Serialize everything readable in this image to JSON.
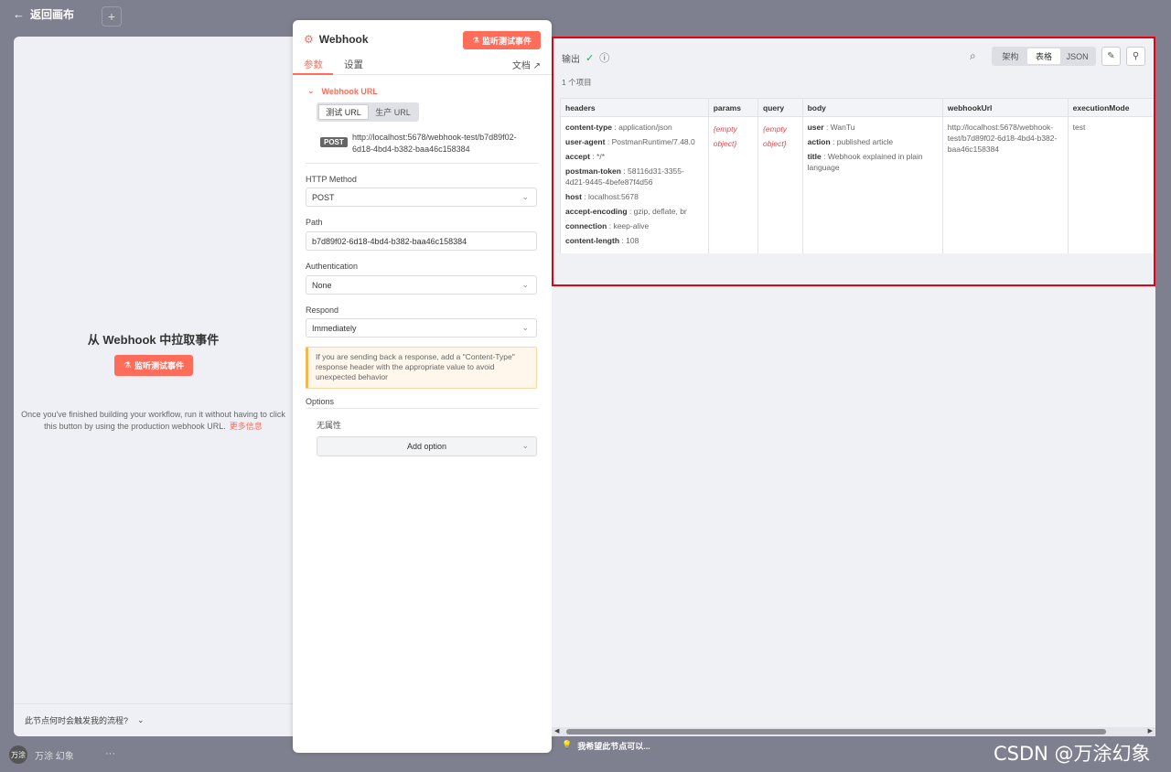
{
  "background": {
    "back_label": "返回画布",
    "plus": "+",
    "user_avatar": "万涂",
    "user_name": "万涂 幻象",
    "dots": "···"
  },
  "left_panel": {
    "title": "从 Webhook 中拉取事件",
    "listen_button": "监听测试事件",
    "description": "Once you've finished building your workflow, run it without having to click this button by using the production webhook URL.",
    "more_info": "更多信息",
    "footer_question": "此节点何时会触发我的流程?"
  },
  "node_panel": {
    "title": "Webhook",
    "listen_button": "监听测试事件",
    "tabs": [
      "参数",
      "设置"
    ],
    "docs": "文档",
    "webhook_url_label": "Webhook URL",
    "url_options": [
      "测试 URL",
      "生产 URL"
    ],
    "method_badge": "POST",
    "url": "http://localhost:5678/webhook-test/b7d89f02-6d18-4bd4-b382-baa46c158384",
    "http_method": {
      "label": "HTTP Method",
      "value": "POST"
    },
    "path": {
      "label": "Path",
      "value": "b7d89f02-6d18-4bd4-b382-baa46c158384"
    },
    "authentication": {
      "label": "Authentication",
      "value": "None"
    },
    "respond": {
      "label": "Respond",
      "value": "Immediately"
    },
    "warning": "If you are sending back a response, add a \"Content-Type\" response header with the appropriate value to avoid unexpected behavior",
    "options_label": "Options",
    "no_properties": "无属性",
    "add_option": "Add option"
  },
  "output_panel": {
    "title": "输出",
    "item_count": "1 个项目",
    "views": [
      "架构",
      "表格",
      "JSON"
    ],
    "selected_view": "表格",
    "columns": [
      "headers",
      "params",
      "query",
      "body",
      "webhookUrl",
      "executionMode"
    ],
    "headers": [
      {
        "k": "content-type",
        "v": "application/json"
      },
      {
        "k": "user-agent",
        "v": "PostmanRuntime/7.48.0"
      },
      {
        "k": "accept",
        "v": "*/*"
      },
      {
        "k": "postman-token",
        "v": "58116d31-3355-4d21-9445-4befe87f4d56"
      },
      {
        "k": "host",
        "v": "localhost:5678"
      },
      {
        "k": "accept-encoding",
        "v": "gzip, deflate, br"
      },
      {
        "k": "connection",
        "v": "keep-alive"
      },
      {
        "k": "content-length",
        "v": "108"
      }
    ],
    "params": "{empty object}",
    "query": "{empty object}",
    "body": [
      {
        "k": "user",
        "v": "WanTu"
      },
      {
        "k": "action",
        "v": "published article"
      },
      {
        "k": "title",
        "v": "Webhook explained in plain language"
      }
    ],
    "webhookUrl": "http://localhost:5678/webhook-test/b7d89f02-6d18-4bd4-b382-baa46c158384",
    "executionMode": "test",
    "hint": "我希望此节点可以..."
  },
  "watermark": "CSDN @万涂幻象",
  "colors": {
    "accent": "#ff6d5a",
    "success": "#22a85a",
    "highlight": "#e60012"
  }
}
